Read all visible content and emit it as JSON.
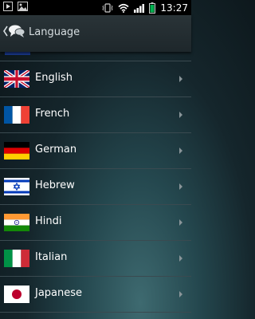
{
  "status_bar": {
    "time": "13:27",
    "icons": [
      "play-icon",
      "picture-icon",
      "vibrate-icon",
      "wifi-icon",
      "signal-icon",
      "battery-icon"
    ]
  },
  "action_bar": {
    "title": "Language",
    "back_icon": "chevron-left-icon",
    "app_icon": "speech-bubbles-icon"
  },
  "languages": [
    {
      "label": "English",
      "flag": "uk-flag"
    },
    {
      "label": "French",
      "flag": "france-flag"
    },
    {
      "label": "German",
      "flag": "germany-flag"
    },
    {
      "label": "Hebrew",
      "flag": "israel-flag"
    },
    {
      "label": "Hindi",
      "flag": "india-flag"
    },
    {
      "label": "Italian",
      "flag": "italy-flag"
    },
    {
      "label": "Japanese",
      "flag": "japan-flag"
    }
  ],
  "colors": {
    "accent_status": "#00b050",
    "divider": "#3a4a50",
    "text": "#ffffff"
  }
}
